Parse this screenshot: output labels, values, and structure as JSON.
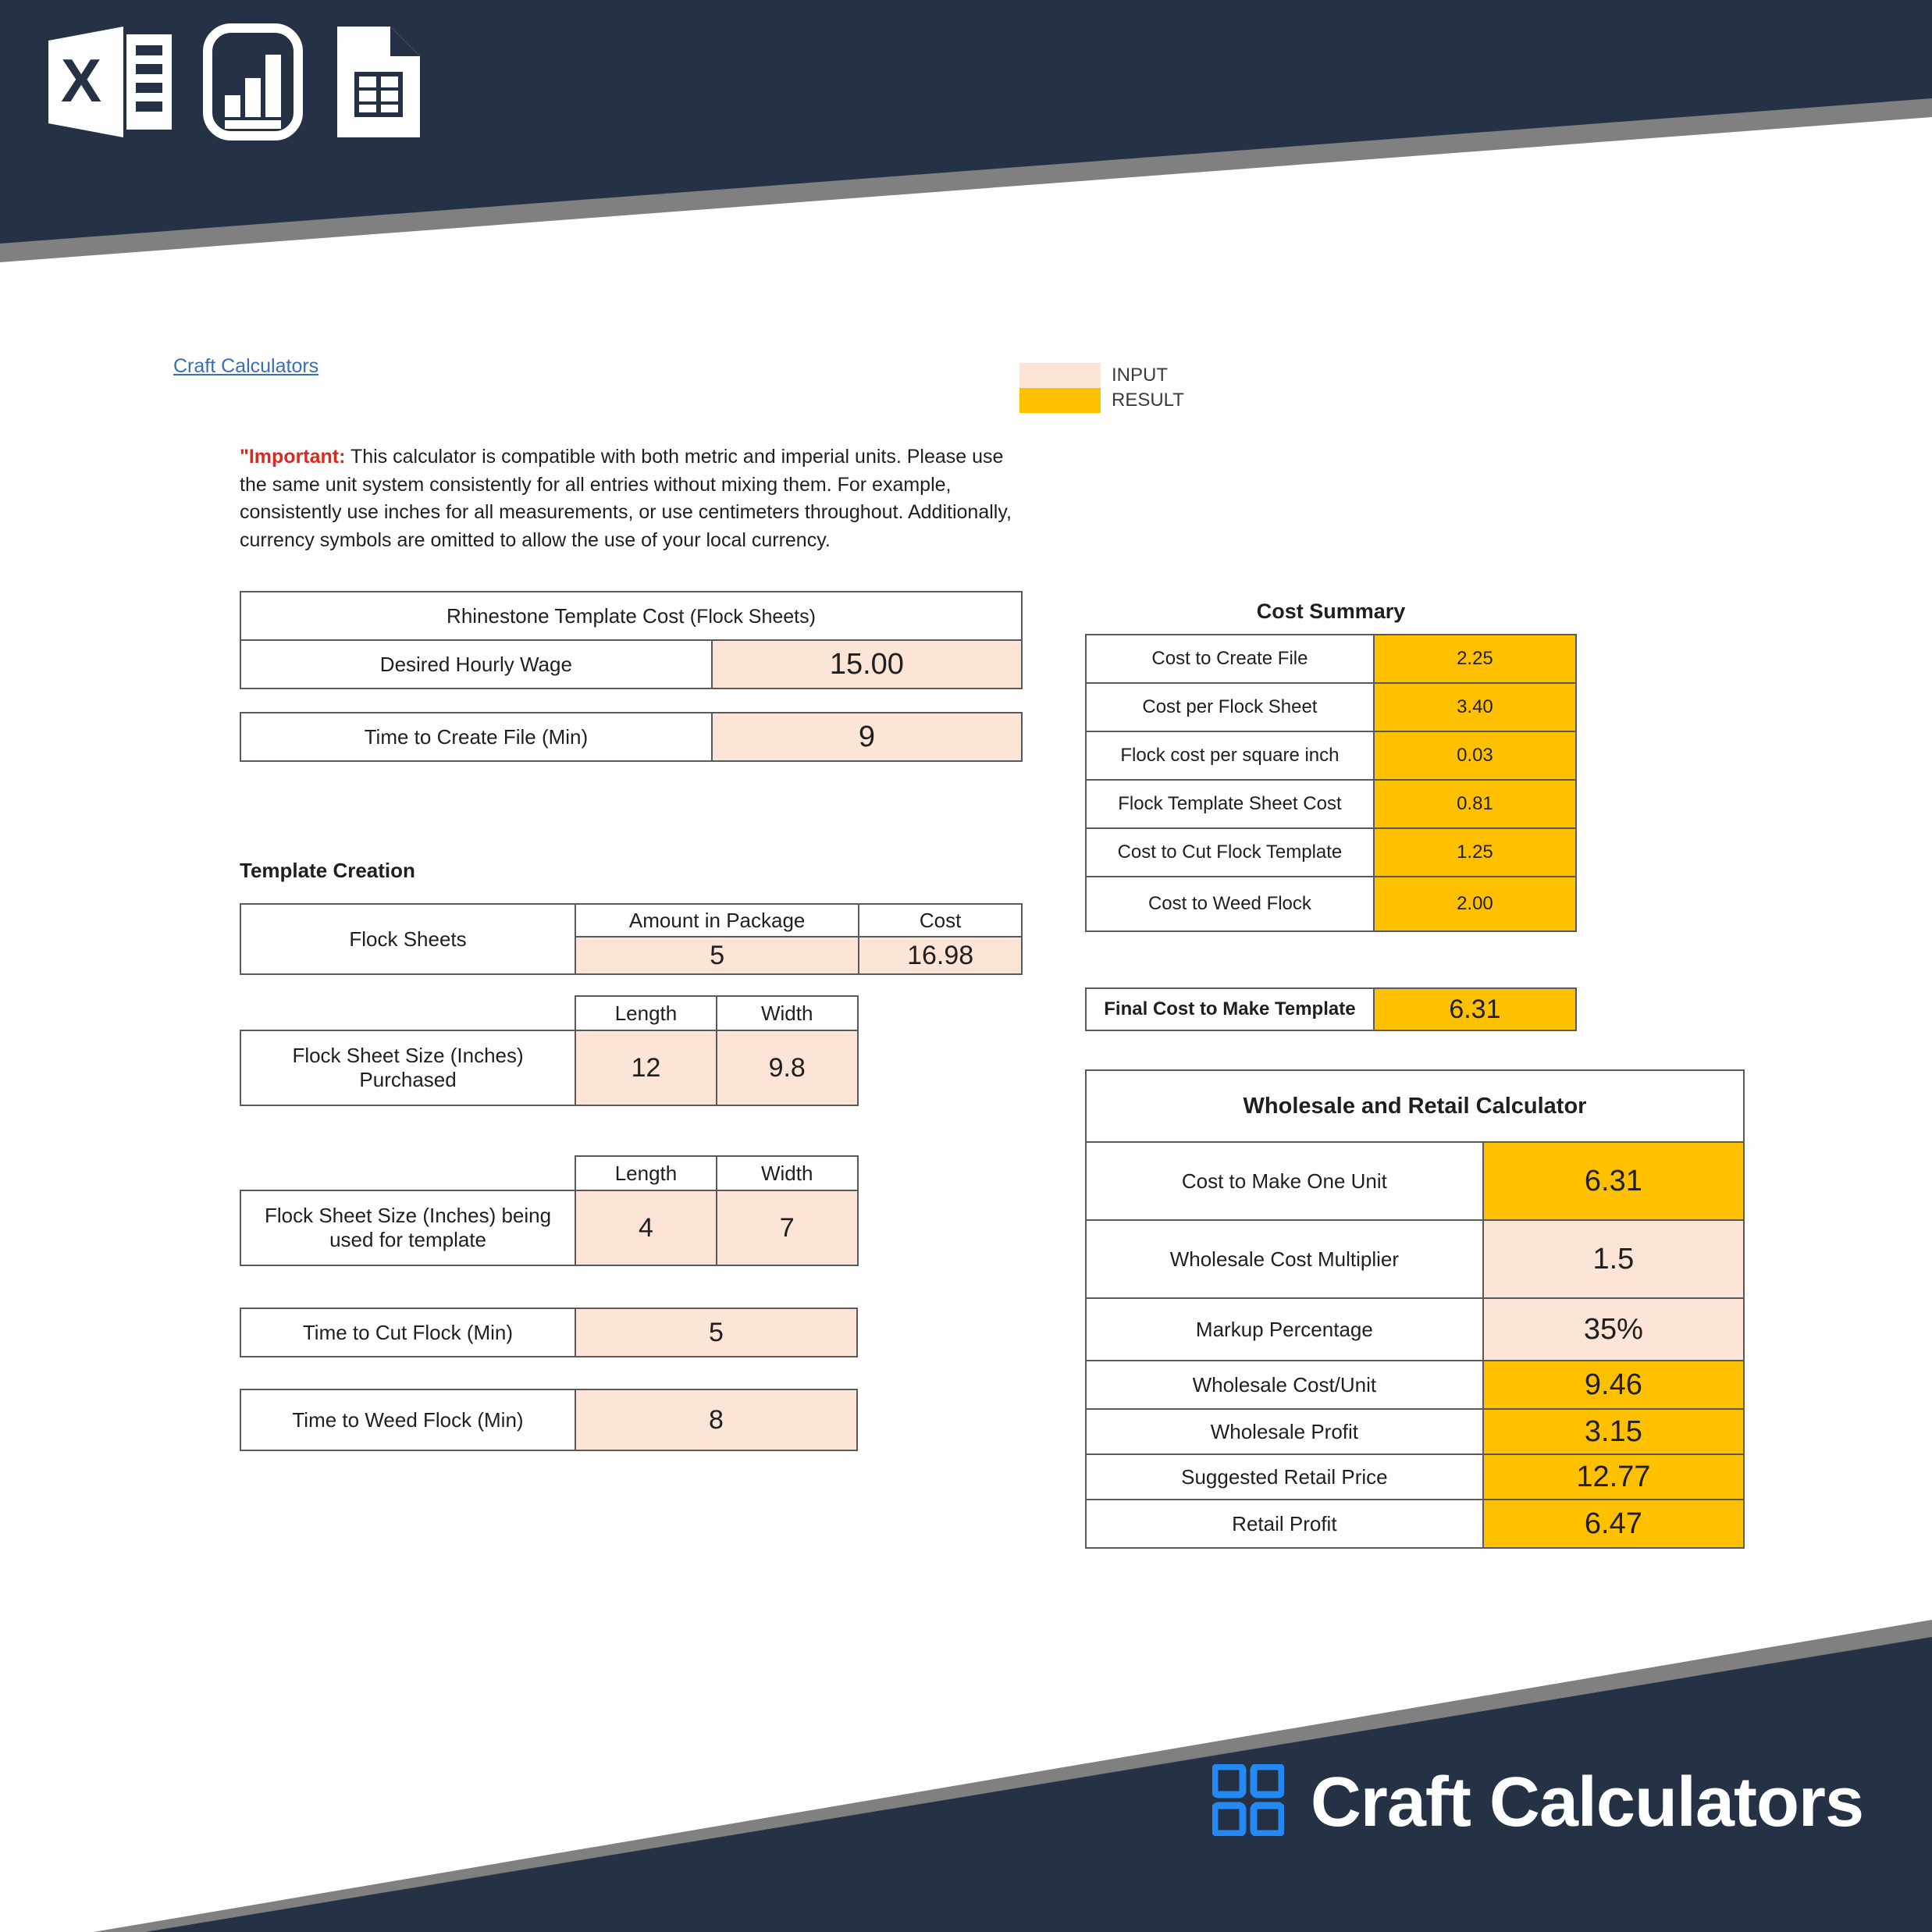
{
  "header": {
    "icons": [
      "excel-file-icon",
      "bar-chart-icon",
      "spreadsheet-document-icon"
    ]
  },
  "footer": {
    "brand_name": "Craft Calculators",
    "logo_icon": "four-squares-grid-icon",
    "accent_color": "#2489f5"
  },
  "link": {
    "label": "Craft Calculators"
  },
  "legend": {
    "input_label": "INPUT",
    "result_label": "RESULT",
    "input_color": "#FCE4D6",
    "result_color": "#FFC000"
  },
  "note": {
    "important_label": "\"Important:",
    "body": " This calculator is compatible with both metric and imperial units. Please use the same unit system consistently for all entries without mixing them. For example, consistently use inches for all measurements, or use centimeters throughout. Additionally, currency symbols are omitted to allow the use of your local currency."
  },
  "main_table": {
    "title": "Rhinestone Template Cost",
    "title_sub": "(Flock Sheets)",
    "rows": [
      {
        "label": "Desired Hourly Wage",
        "value": "15.00",
        "kind": "input"
      },
      {
        "label": "Time to Create File (Min)",
        "value": "9",
        "kind": "input"
      }
    ]
  },
  "template_creation": {
    "section_label": "Template Creation",
    "flock_sheets": {
      "label": "Flock Sheets",
      "headers": [
        "Amount in Package",
        "Cost"
      ],
      "values": [
        "5",
        "16.98"
      ]
    },
    "size_purchased": {
      "label": "Flock Sheet Size (Inches) Purchased",
      "headers": [
        "Length",
        "Width"
      ],
      "values": [
        "12",
        "9.8"
      ]
    },
    "size_used": {
      "label": "Flock Sheet Size (Inches)  being used for template",
      "headers": [
        "Length",
        "Width"
      ],
      "values": [
        "4",
        "7"
      ]
    },
    "time_rows": [
      {
        "label": "Time to Cut Flock (Min)",
        "value": "5",
        "kind": "input"
      },
      {
        "label": "Time to Weed Flock (Min)",
        "value": "8",
        "kind": "input"
      }
    ]
  },
  "cost_summary": {
    "caption": "Cost Summary",
    "rows": [
      {
        "label": "Cost to Create File",
        "value": "2.25",
        "kind": "result"
      },
      {
        "label": "Cost per Flock Sheet",
        "value": "3.40",
        "kind": "result"
      },
      {
        "label": "Flock cost per square inch",
        "value": "0.03",
        "kind": "result"
      },
      {
        "label": "Flock Template Sheet Cost",
        "value": "0.81",
        "kind": "result"
      },
      {
        "label": "Cost to Cut Flock Template",
        "value": "1.25",
        "kind": "result"
      },
      {
        "label": "Cost to Weed Flock",
        "value": "2.00",
        "kind": "result"
      }
    ]
  },
  "final_cost": {
    "label": "Final Cost to Make Template",
    "value": "6.31",
    "kind": "result"
  },
  "wholesale_retail": {
    "title": "Wholesale and Retail Calculator",
    "rows": [
      {
        "label": "Cost to Make One Unit",
        "value": "6.31",
        "kind": "result"
      },
      {
        "label": "Wholesale Cost Multiplier",
        "value": "1.5",
        "kind": "input"
      },
      {
        "label": "Markup Percentage",
        "value": "35%",
        "kind": "input"
      },
      {
        "label": "Wholesale Cost/Unit",
        "value": "9.46",
        "kind": "result"
      },
      {
        "label": "Wholesale Profit",
        "value": "3.15",
        "kind": "result"
      },
      {
        "label": "Suggested Retail Price",
        "value": "12.77",
        "kind": "result"
      },
      {
        "label": "Retail Profit",
        "value": "6.47",
        "kind": "result"
      }
    ]
  }
}
